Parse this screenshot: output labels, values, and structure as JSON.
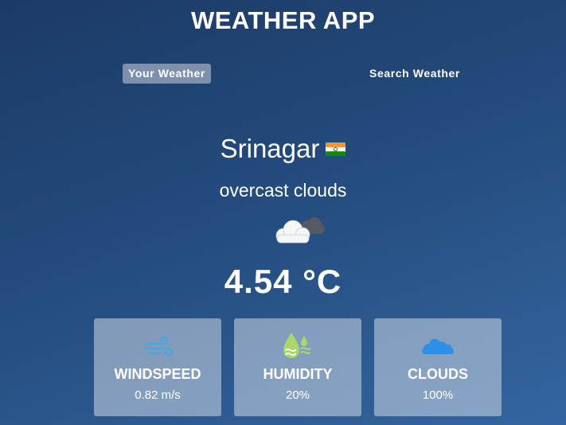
{
  "app": {
    "title": "WEATHER APP"
  },
  "tabs": [
    {
      "label": "Your Weather",
      "active": true
    },
    {
      "label": "Search Weather",
      "active": false
    }
  ],
  "weather": {
    "city": "Srinagar",
    "country_flag_icon": "india-flag-icon",
    "description": "overcast clouds",
    "condition_icon": "overcast-clouds-icon",
    "temperature": "4.54 °C"
  },
  "stats": [
    {
      "icon": "wind-icon",
      "label": "WINDSPEED",
      "value": "0.82 m/s"
    },
    {
      "icon": "humidity-drops-icon",
      "label": "HUMIDITY",
      "value": "20%"
    },
    {
      "icon": "clouds-icon",
      "label": "CLOUDS",
      "value": "100%"
    }
  ],
  "colors": {
    "background_top": "#1d3a66",
    "background_bottom": "#3465a0",
    "wind_icon": "#4da3e0",
    "humidity_icon": "#a8d86a",
    "clouds_icon": "#2e8fe6"
  }
}
